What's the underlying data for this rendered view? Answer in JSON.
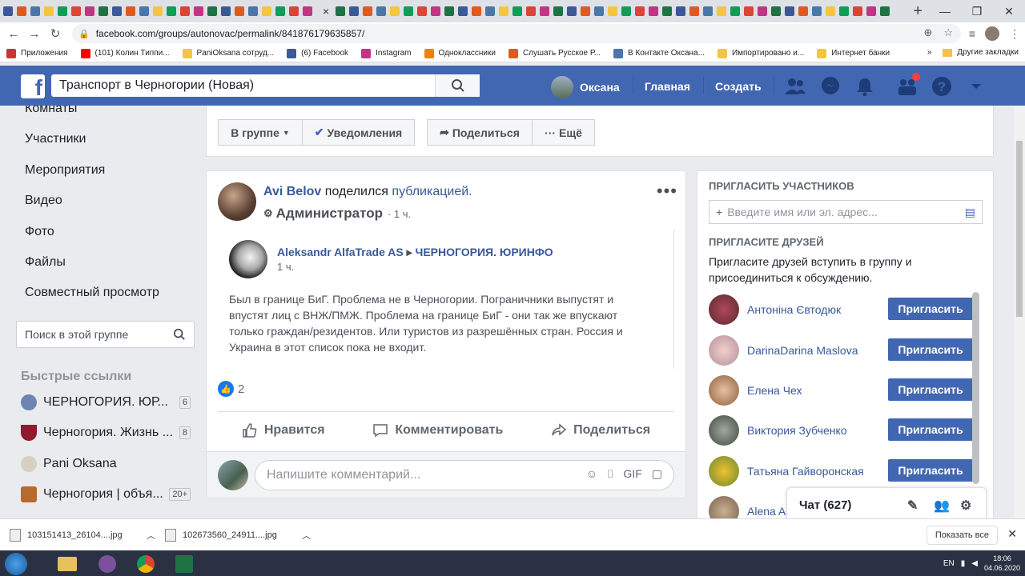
{
  "browser": {
    "url": "facebook.com/groups/autonovac/permalink/841876179635857/",
    "bookmarks": [
      {
        "label": "Приложения",
        "color": "#cc3333"
      },
      {
        "label": "(101) Колин Типпи...",
        "color": "#ff0000"
      },
      {
        "label": "PaniOksana сотруд...",
        "color": "#f4c542"
      },
      {
        "label": "(6) Facebook",
        "color": "#3b5998"
      },
      {
        "label": "Instagram",
        "color": "#c13584"
      },
      {
        "label": "Одноклассники",
        "color": "#ee8208"
      },
      {
        "label": "Слушать Русское Р...",
        "color": "#e05a1f"
      },
      {
        "label": "В Контакте Оксана...",
        "color": "#4a76a8"
      },
      {
        "label": "Импортировано и...",
        "color": "#f4c542"
      },
      {
        "label": "Интернет банки",
        "color": "#f4c542"
      }
    ],
    "bookmarks_more": "»",
    "other_bookmarks": "Другие закладки"
  },
  "fb": {
    "search_value": "Транспорт в Черногории (Новая)",
    "user_name": "Оксана",
    "nav_home": "Главная",
    "nav_create": "Создать",
    "brand_color": "#4267b2"
  },
  "leftnav": {
    "items": [
      "Комнаты",
      "Участники",
      "Мероприятия",
      "Видео",
      "Фото",
      "Файлы",
      "Совместный просмотр"
    ],
    "search_placeholder": "Поиск в этой группе",
    "quick_title": "Быстрые ссылки",
    "quick_links": [
      {
        "name": "ЧЕРНОГОРИЯ. ЮР...",
        "count": "6"
      },
      {
        "name": "Черногория. Жизнь ...",
        "count": "8"
      },
      {
        "name": "Pani Oksana",
        "count": ""
      },
      {
        "name": "Черногория | объя...",
        "count": "20+"
      }
    ]
  },
  "actionbar": {
    "in_group": "В группе",
    "notifications": "Уведомления",
    "share": "Поделиться",
    "more": "Ещё"
  },
  "post": {
    "author": "Avi Belov",
    "shared_label": "поделился",
    "shared_link": "публикацией.",
    "role": "Администратор",
    "time": "1 ч.",
    "shared": {
      "author": "Aleksandr AlfaTrade AS",
      "group": "ЧЕРНОГОРИЯ. ЮРИНФО",
      "time": "1 ч.",
      "text": "Был в границе БиГ. Проблема не в Черногории. Пограничники выпустят и впустят лиц с ВНЖ/ПМЖ. Проблема на границе БиГ - они так же впускают только граждан/резидентов. Или туристов из разрешённых стран. Россия и Украина в этот список пока не входит."
    },
    "likes": "2",
    "like_label": "Нравится",
    "comment_label": "Комментировать",
    "share_label": "Поделиться",
    "comment_placeholder": "Напишите комментарий..."
  },
  "right": {
    "invite_title": "ПРИГЛАСИТЬ УЧАСТНИКОВ",
    "invite_placeholder": "Введите имя или эл. адрес...",
    "friends_title": "ПРИГЛАСИТЕ ДРУЗЕЙ",
    "friends_desc": "Пригласите друзей вступить в группу и присоединиться к обсуждению.",
    "invite_button": "Пригласить",
    "friends": [
      {
        "name": "Антоніна Євтодюк"
      },
      {
        "name": "DarinaDarina Maslova"
      },
      {
        "name": "Елена Чех"
      },
      {
        "name": "Виктория Зубченко"
      },
      {
        "name": "Татьяна Гайворонская"
      },
      {
        "name": "Alena A"
      }
    ]
  },
  "chat": {
    "label": "Чат (627)"
  },
  "downloads": {
    "files": [
      "103151413_26104....jpg",
      "102673560_24911....jpg"
    ],
    "show_all": "Показать все"
  },
  "taskbar": {
    "lang": "EN",
    "time": "18:06",
    "date": "04.06.2020"
  }
}
